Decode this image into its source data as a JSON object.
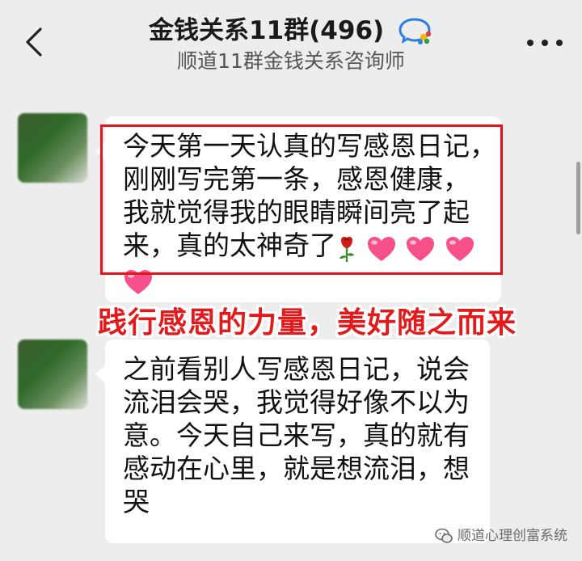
{
  "header": {
    "title": "金钱关系11群(496)",
    "subtitle": "顺道11群金钱关系咨询师"
  },
  "messages": [
    {
      "lines": [
        "今天第一天认真的写感恩日记，",
        "刚刚写完第一条，感恩健康，",
        "我就觉得我的眼睛瞬间亮了起",
        "来，真的太神奇了"
      ],
      "emoji": [
        "rose-emoji",
        "heart-emoji",
        "heart-emoji",
        "heart-emoji",
        "heart-emoji"
      ]
    },
    {
      "lines": [
        "之前看别人写感恩日记，说会",
        "流泪会哭，我觉得好像不以为",
        "意。今天自己来写，真的就有",
        "感动在心里，就是想流泪，想",
        "哭"
      ]
    }
  ],
  "overlay": {
    "caption": "践行感恩的力量，美好随之而来",
    "highlight_color": "#e5141b",
    "caption_color": "#e31a1c"
  },
  "watermark": {
    "text": "顺道心理创富系统"
  }
}
